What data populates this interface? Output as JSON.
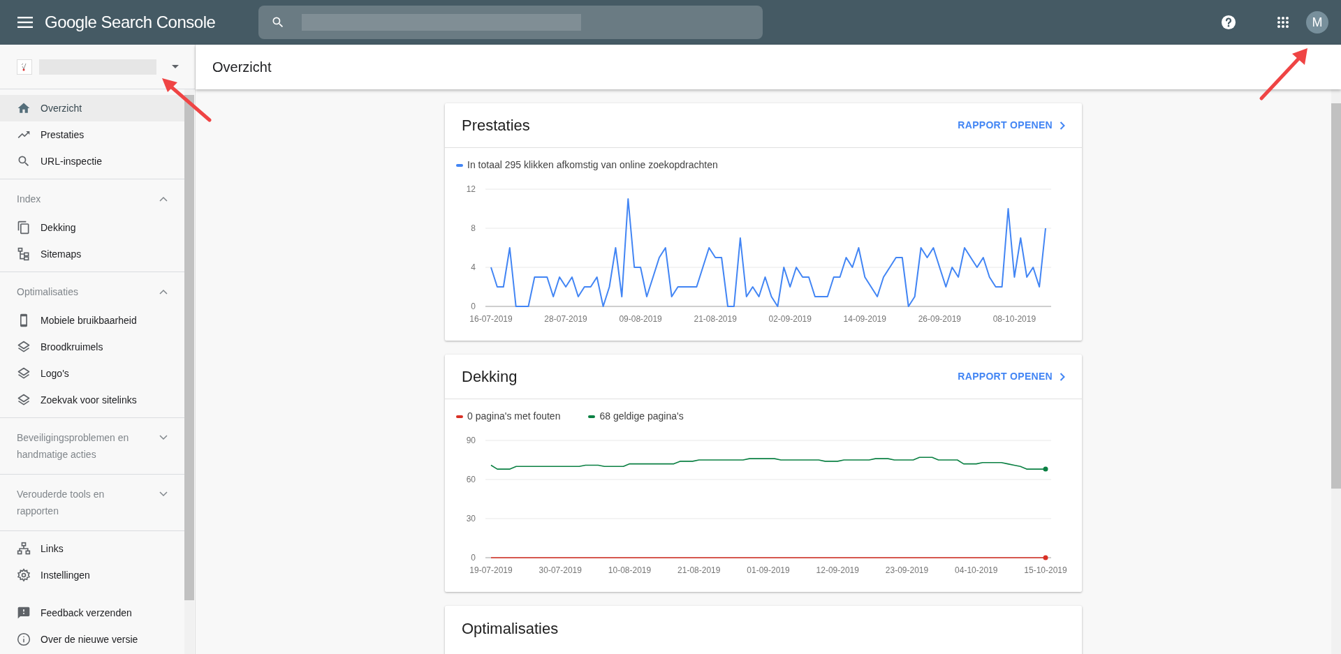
{
  "app_bar": {
    "title": "Google Search Console",
    "avatar_initial": "M"
  },
  "page_title": "Overzicht",
  "sidebar": {
    "sections": [
      {
        "items": [
          {
            "label": "Overzicht",
            "selected": true
          },
          {
            "label": "Prestaties",
            "selected": false
          },
          {
            "label": "URL-inspectie",
            "selected": false
          }
        ]
      },
      {
        "heading": "Index",
        "expanded": true,
        "items": [
          {
            "label": "Dekking",
            "selected": false
          },
          {
            "label": "Sitemaps",
            "selected": false
          }
        ]
      },
      {
        "heading": "Optimalisaties",
        "expanded": true,
        "items": [
          {
            "label": "Mobiele bruikbaarheid",
            "selected": false
          },
          {
            "label": "Broodkruimels",
            "selected": false
          },
          {
            "label": "Logo's",
            "selected": false
          },
          {
            "label": "Zoekvak voor sitelinks",
            "selected": false
          }
        ]
      },
      {
        "heading": "Beveiligingsproblemen en handmatige acties",
        "expanded": false
      },
      {
        "heading": "Verouderde tools en rapporten",
        "expanded": false
      },
      {
        "items": [
          {
            "label": "Links",
            "selected": false
          },
          {
            "label": "Instellingen",
            "selected": false
          }
        ]
      },
      {
        "items": [
          {
            "label": "Feedback verzenden",
            "selected": false
          },
          {
            "label": "Over de nieuwe versie",
            "selected": false
          }
        ]
      }
    ]
  },
  "cards": [
    {
      "title": "Prestaties",
      "action": "RAPPORT OPENEN",
      "chart_data": {
        "type": "line",
        "ylim": [
          0,
          12
        ],
        "yticks": [
          0,
          4,
          8,
          12
        ],
        "categories": [
          "16-07-2019",
          null,
          null,
          null,
          null,
          null,
          null,
          null,
          null,
          null,
          null,
          null,
          "28-07-2019",
          null,
          null,
          null,
          null,
          null,
          null,
          null,
          null,
          null,
          null,
          null,
          "09-08-2019",
          null,
          null,
          null,
          null,
          null,
          null,
          null,
          null,
          null,
          null,
          null,
          "21-08-2019",
          null,
          null,
          null,
          null,
          null,
          null,
          null,
          null,
          null,
          null,
          null,
          "02-09-2019",
          null,
          null,
          null,
          null,
          null,
          null,
          null,
          null,
          null,
          null,
          null,
          "14-09-2019",
          null,
          null,
          null,
          null,
          null,
          null,
          null,
          null,
          null,
          null,
          null,
          "26-09-2019",
          null,
          null,
          null,
          null,
          null,
          null,
          null,
          null,
          null,
          null,
          null,
          "08-10-2019",
          null,
          null,
          null,
          null,
          null
        ],
        "series": [
          {
            "name": "In totaal 295 klikken afkomstig van online zoekopdrachten",
            "color": "#4285f4",
            "values": [
              4,
              2,
              2,
              6,
              0,
              0,
              0,
              3,
              3,
              3,
              1,
              3,
              2,
              3,
              1,
              2,
              2,
              3,
              0,
              2,
              6,
              1,
              11,
              4,
              4,
              1,
              3,
              5,
              6,
              1,
              2,
              2,
              2,
              2,
              4,
              6,
              5,
              5,
              0,
              0,
              7,
              1,
              2,
              1,
              3,
              1,
              0,
              4,
              2,
              4,
              3,
              3,
              1,
              1,
              1,
              3,
              3,
              5,
              4,
              6,
              3,
              2,
              1,
              3,
              4,
              5,
              5,
              0,
              1,
              6,
              5,
              6,
              4,
              2,
              4,
              3,
              6,
              5,
              4,
              5,
              3,
              2,
              2,
              10,
              3,
              7,
              3,
              4,
              2,
              8
            ]
          }
        ]
      }
    },
    {
      "title": "Dekking",
      "action": "RAPPORT OPENEN",
      "chart_data": {
        "type": "line",
        "ylim": [
          0,
          90
        ],
        "yticks": [
          0,
          30,
          60,
          90
        ],
        "categories": [
          "19-07-2019",
          null,
          null,
          null,
          null,
          null,
          null,
          null,
          null,
          null,
          null,
          "30-07-2019",
          null,
          null,
          null,
          null,
          null,
          null,
          null,
          null,
          null,
          null,
          "10-08-2019",
          null,
          null,
          null,
          null,
          null,
          null,
          null,
          null,
          null,
          null,
          "21-08-2019",
          null,
          null,
          null,
          null,
          null,
          null,
          null,
          null,
          null,
          null,
          "01-09-2019",
          null,
          null,
          null,
          null,
          null,
          null,
          null,
          null,
          null,
          null,
          "12-09-2019",
          null,
          null,
          null,
          null,
          null,
          null,
          null,
          null,
          null,
          null,
          "23-09-2019",
          null,
          null,
          null,
          null,
          null,
          null,
          null,
          null,
          null,
          null,
          "04-10-2019",
          null,
          null,
          null,
          null,
          null,
          null,
          null,
          null,
          null,
          null,
          "15-10-2019"
        ],
        "series": [
          {
            "name": "0 pagina's met fouten",
            "color": "#d93025",
            "values": [
              0,
              0,
              0,
              0,
              0,
              0,
              0,
              0,
              0,
              0,
              0,
              0,
              0,
              0,
              0,
              0,
              0,
              0,
              0,
              0,
              0,
              0,
              0,
              0,
              0,
              0,
              0,
              0,
              0,
              0,
              0,
              0,
              0,
              0,
              0,
              0,
              0,
              0,
              0,
              0,
              0,
              0,
              0,
              0,
              0,
              0,
              0,
              0,
              0,
              0,
              0,
              0,
              0,
              0,
              0,
              0,
              0,
              0,
              0,
              0,
              0,
              0,
              0,
              0,
              0,
              0,
              0,
              0,
              0,
              0,
              0,
              0,
              0,
              0,
              0,
              0,
              0,
              0,
              0,
              0,
              0,
              0,
              0,
              0,
              0,
              0,
              0,
              0,
              0
            ]
          },
          {
            "name": "68 geldige pagina's",
            "color": "#0b8043",
            "values": [
              71,
              68,
              68,
              68,
              70,
              70,
              70,
              70,
              70,
              70,
              70,
              70,
              70,
              70,
              70,
              71,
              71,
              71,
              70,
              70,
              70,
              70,
              72,
              72,
              72,
              72,
              72,
              72,
              72,
              72,
              74,
              74,
              74,
              75,
              75,
              75,
              75,
              75,
              75,
              75,
              75,
              76,
              76,
              76,
              76,
              76,
              75,
              75,
              75,
              75,
              75,
              75,
              75,
              74,
              74,
              74,
              75,
              75,
              75,
              75,
              75,
              76,
              76,
              76,
              75,
              75,
              75,
              75,
              77,
              77,
              77,
              75,
              75,
              75,
              75,
              72,
              72,
              72,
              73,
              73,
              73,
              73,
              72,
              71,
              70,
              68,
              68,
              68,
              68
            ]
          }
        ]
      }
    },
    {
      "title": "Optimalisaties"
    }
  ]
}
